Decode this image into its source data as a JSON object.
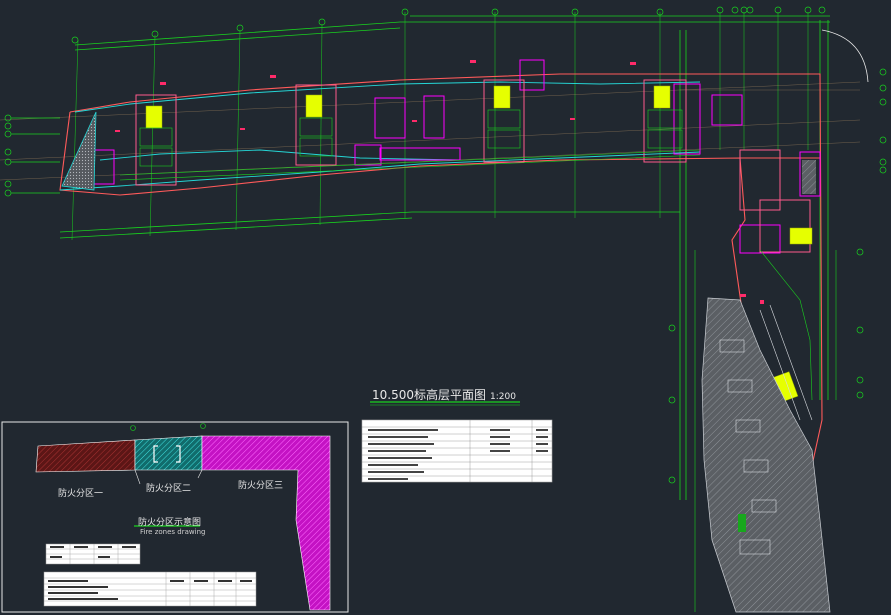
{
  "drawing": {
    "title": "10.500标高层平面图",
    "scale": "1:200"
  },
  "fire_zone_diagram": {
    "title": "防火分区示意图",
    "subtitle": "Fire zones drawing",
    "zones": [
      "防火分区一",
      "防火分区二",
      "防火分区三"
    ]
  },
  "colors": {
    "background": "#212830",
    "grid": "#19d11f",
    "outline": "#ff5a5a",
    "magenta": "#ff00ff",
    "yellow": "#e6ff00",
    "cyan": "#25d6d6",
    "zone_one": "#6b1a1a",
    "zone_two": "#1a8a8a",
    "zone_three": "#d51fd5"
  }
}
